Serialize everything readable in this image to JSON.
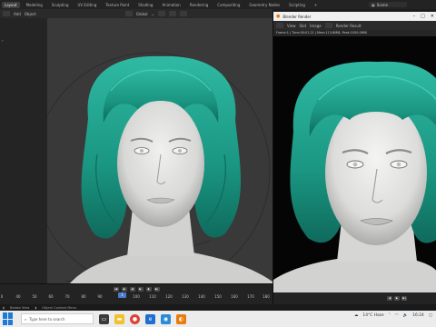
{
  "menubar": {
    "tabs": [
      "Layout",
      "Modeling",
      "Sculpting",
      "UV Editing",
      "Texture Paint",
      "Shading",
      "Animation",
      "Rendering",
      "Compositing",
      "Geometry Nodes",
      "Scripting",
      "+"
    ],
    "active_tab": "Layout",
    "scene_label": "Scene"
  },
  "viewport_header": {
    "mode_items": [
      "Add",
      "Object"
    ],
    "orientation": "Global"
  },
  "timeline": {
    "ticks": [
      "0",
      "40",
      "50",
      "60",
      "70",
      "80",
      "90",
      "100",
      "110",
      "120",
      "130",
      "140",
      "150",
      "160",
      "170",
      "180"
    ],
    "current_frame": "1"
  },
  "render_window": {
    "title": "Blender Render",
    "menu": [
      "View",
      "Slot",
      "Image"
    ],
    "pass_label": "Render Result",
    "info": "Frame:1 | Time:00:01.21 | Mem:113.8MiB, Peak:1050.0MiB"
  },
  "statusbar": {
    "items": [
      "Rotate View",
      "Object Context Menu"
    ]
  },
  "taskbar": {
    "search_placeholder": "Type here to search",
    "weather": "14°C Haze",
    "time": "16:24"
  },
  "colors": {
    "hair": "#1f9e8c",
    "hair_dark": "#0f5a4e",
    "skin": "#e4e4e2",
    "viewport_bg": "#393939",
    "accent": "#4a7bd0"
  }
}
